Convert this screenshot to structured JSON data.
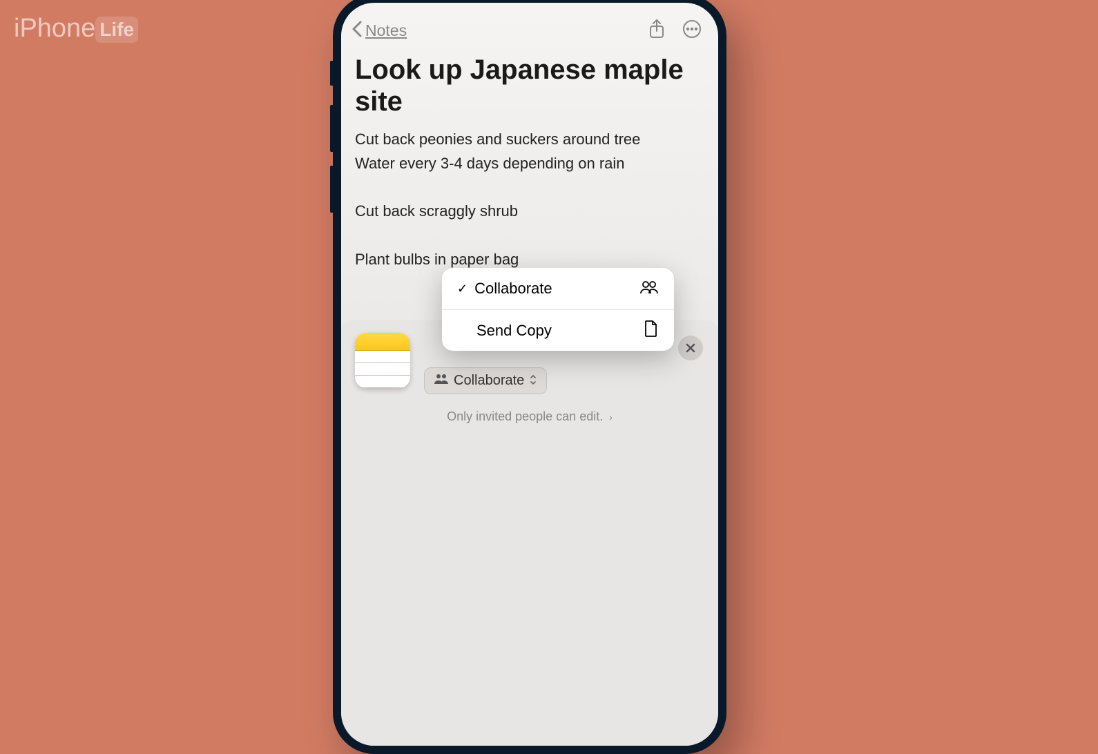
{
  "watermark": {
    "prefix": "iPhone",
    "suffix": "Life"
  },
  "topbar": {
    "back_label": "Notes"
  },
  "note": {
    "title": "Look up Japanese maple site",
    "lines": [
      "Cut back peonies and suckers around tree",
      "Water every 3-4 days depending on rain",
      "",
      "Cut back scraggly shrub",
      "",
      "Plant bulbs in paper bag"
    ]
  },
  "popup": {
    "items": [
      {
        "label": "Collaborate",
        "checked": true,
        "icon": "people"
      },
      {
        "label": "Send Copy",
        "checked": false,
        "icon": "document"
      }
    ]
  },
  "share_sheet": {
    "collab_label": "Collaborate",
    "footer_text": "Only invited people can edit."
  }
}
